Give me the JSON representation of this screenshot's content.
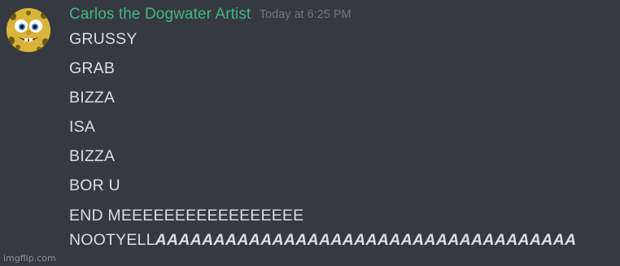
{
  "message": {
    "author": {
      "name": "Carlos the Dogwater Artist",
      "name_color": "#43b581",
      "avatar_icon": "spongebob-avatar-icon"
    },
    "timestamp": "Today at 6:25 PM",
    "lines": [
      "GRUSSY",
      "GRAB",
      "BIZZA",
      "ISA",
      "BIZZA",
      "BOR U",
      "END MEEEEEEEEEEEEEEEEE"
    ],
    "last_line": {
      "plain": "NOOTYELL",
      "emphasized": "AAAAAAAAAAAAAAAAAAAAAAAAAAAAAAAAAAAA"
    }
  },
  "watermark": "imgflip.com",
  "colors": {
    "background": "#36393f",
    "text": "#dcddde",
    "timestamp": "#72767d"
  }
}
